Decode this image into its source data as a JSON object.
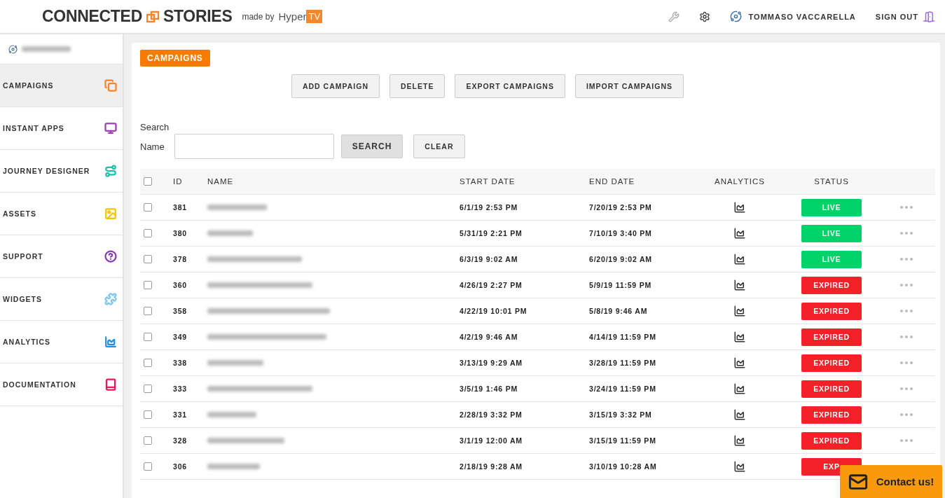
{
  "header": {
    "logo_left": "CONNECTED",
    "logo_right": "STORIES",
    "made_by": "made by",
    "brand": "Hyper",
    "brand_badge": "TV",
    "user": "TOMMASO VACCARELLA",
    "sign_out": "SIGN OUT"
  },
  "sidebar": {
    "items": [
      {
        "label": "CAMPAIGNS",
        "selected": true,
        "kind": "campaigns",
        "color": "#f7862a"
      },
      {
        "label": "INSTANT APPS",
        "selected": false,
        "kind": "apps",
        "color": "#9b3fb5"
      },
      {
        "label": "JOURNEY DESIGNER",
        "selected": false,
        "kind": "journey",
        "color": "#1fbfa8"
      },
      {
        "label": "ASSETS",
        "selected": false,
        "kind": "assets",
        "color": "#f3c400"
      },
      {
        "label": "SUPPORT",
        "selected": false,
        "kind": "support",
        "color": "#8e35b8"
      },
      {
        "label": "WIDGETS",
        "selected": false,
        "kind": "widgets",
        "color": "#7cc7f0"
      },
      {
        "label": "ANALYTICS",
        "selected": false,
        "kind": "analytics",
        "color": "#1e90e8"
      },
      {
        "label": "DOCUMENTATION",
        "selected": false,
        "kind": "docs",
        "color": "#f0145a"
      }
    ]
  },
  "page_tag": "CAMPAIGNS",
  "actions": [
    "ADD CAMPAIGN",
    "DELETE",
    "EXPORT CAMPAIGNS",
    "IMPORT CAMPAIGNS"
  ],
  "search": {
    "title": "Search",
    "label": "Name",
    "button": "SEARCH",
    "clear": "CLEAR"
  },
  "table": {
    "columns": [
      "ID",
      "NAME",
      "START DATE",
      "END DATE",
      "ANALYTICS",
      "STATUS"
    ],
    "all_checked": false,
    "rows": [
      {
        "id": "381",
        "start": "6/1/19 2:53 PM",
        "end": "7/20/19 2:53 PM",
        "status": "LIVE",
        "kind": "live",
        "checked": false
      },
      {
        "id": "380",
        "start": "5/31/19 2:21 PM",
        "end": "7/10/19 3:40 PM",
        "status": "LIVE",
        "kind": "live",
        "checked": false
      },
      {
        "id": "378",
        "start": "6/3/19 9:02 AM",
        "end": "6/20/19 9:02 AM",
        "status": "LIVE",
        "kind": "live",
        "checked": false
      },
      {
        "id": "360",
        "start": "4/26/19 2:27 PM",
        "end": "5/9/19 11:59 PM",
        "status": "EXPIRED",
        "kind": "expired",
        "checked": false
      },
      {
        "id": "358",
        "start": "4/22/19 10:01 PM",
        "end": "5/8/19 9:46 AM",
        "status": "EXPIRED",
        "kind": "expired",
        "checked": false
      },
      {
        "id": "349",
        "start": "4/2/19 9:46 AM",
        "end": "4/14/19 11:59 PM",
        "status": "EXPIRED",
        "kind": "expired",
        "checked": false
      },
      {
        "id": "338",
        "start": "3/13/19 9:29 AM",
        "end": "3/28/19 11:59 PM",
        "status": "EXPIRED",
        "kind": "expired",
        "checked": false
      },
      {
        "id": "333",
        "start": "3/5/19 1:46 PM",
        "end": "3/24/19 11:59 PM",
        "status": "EXPIRED",
        "kind": "expired",
        "checked": false
      },
      {
        "id": "331",
        "start": "2/28/19 3:32 PM",
        "end": "3/15/19 3:32 PM",
        "status": "EXPIRED",
        "kind": "expired",
        "checked": false
      },
      {
        "id": "328",
        "start": "3/1/19 12:00 AM",
        "end": "3/15/19 11:59 PM",
        "status": "EXPIRED",
        "kind": "expired",
        "checked": false
      },
      {
        "id": "306",
        "start": "2/18/19 9:28 AM",
        "end": "3/10/19 10:28 AM",
        "status": "EXP",
        "kind": "expired",
        "checked": false
      }
    ]
  },
  "contact": "Contact us!"
}
